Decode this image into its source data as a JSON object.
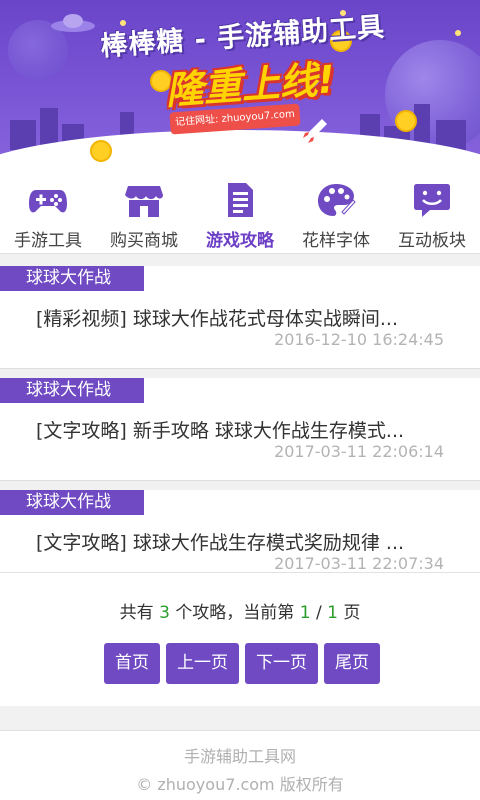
{
  "banner": {
    "title": "棒棒糖 - 手游辅助工具",
    "slogan": "隆重上线!",
    "url_note": "记住网址: zhuoyou7.com"
  },
  "nav": {
    "items": [
      {
        "label": "手游工具",
        "icon": "gamepad-icon"
      },
      {
        "label": "购买商城",
        "icon": "store-icon"
      },
      {
        "label": "游戏攻略",
        "icon": "document-icon",
        "active": true
      },
      {
        "label": "花样字体",
        "icon": "palette-icon"
      },
      {
        "label": "互动板块",
        "icon": "chat-smile-icon"
      }
    ]
  },
  "articles": [
    {
      "tag": "球球大作战",
      "title": "[精彩视频] 球球大作战花式母体实战瞬间...",
      "time": "2016-12-10 16:24:45"
    },
    {
      "tag": "球球大作战",
      "title": "[文字攻略] 新手攻略 球球大作战生存模式...",
      "time": "2017-03-11 22:06:14"
    },
    {
      "tag": "球球大作战",
      "title": "[文字攻略] 球球大作战生存模式奖励规律 ...",
      "time": "2017-03-11 22:07:34"
    }
  ],
  "pager": {
    "prefix": "共有",
    "total": "3",
    "middle": "个攻略，当前第",
    "current": "1",
    "sep": "/",
    "pages": "1",
    "suffix": "页",
    "first": "首页",
    "prev": "上一页",
    "next": "下一页",
    "last": "尾页"
  },
  "footer": {
    "site_name": "手游辅助工具网",
    "copyright": "© zhuoyou7.com 版权所有"
  },
  "colors": {
    "accent": "#6f4ac3",
    "highlight_number": "#2a9d2a",
    "timestamp": "#b3b3b3"
  }
}
